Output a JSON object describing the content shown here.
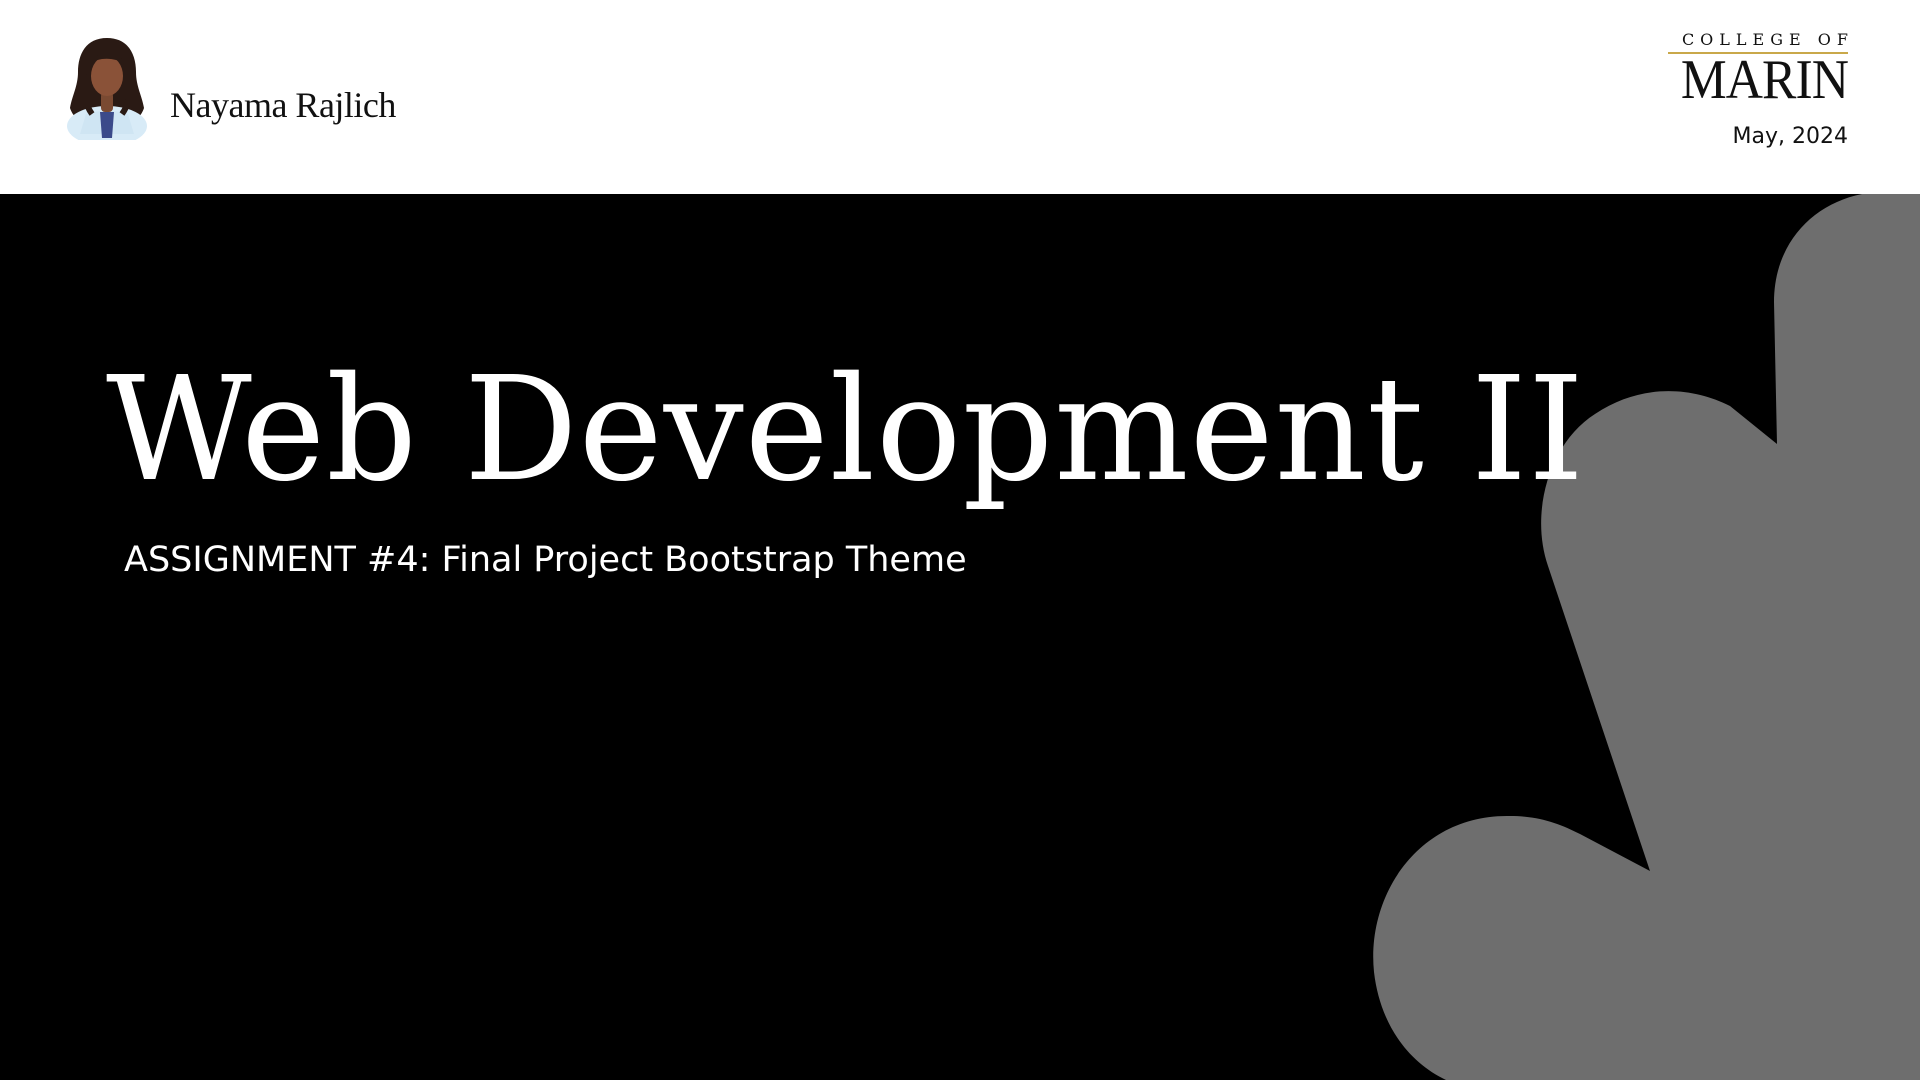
{
  "header": {
    "author_name": "Nayama Rajlich",
    "logo": {
      "line1": "COLLEGE OF",
      "line2": "MARIN"
    },
    "date": "May, 2024"
  },
  "main": {
    "title": "Web Development II",
    "subtitle": "ASSIGNMENT #4: Final Project Bootstrap Theme"
  },
  "colors": {
    "background": "#000000",
    "header_background": "#ffffff",
    "decoration": "#6e6e6e",
    "logo_rule": "#c9a84a"
  },
  "icons": {
    "avatar": "woman-avatar-icon",
    "decoration": "hand-pointer-shape"
  }
}
